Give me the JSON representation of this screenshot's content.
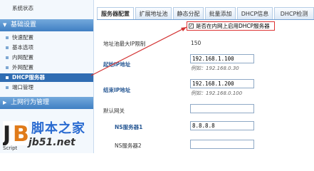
{
  "sidebar": {
    "system_status": "系统状态",
    "basic_settings": "基础设置",
    "items": [
      {
        "label": "快速配置"
      },
      {
        "label": "基本选项"
      },
      {
        "label": "内网配置"
      },
      {
        "label": "外网配置"
      },
      {
        "label": "DHCP服务器"
      },
      {
        "label": "端口管理"
      }
    ],
    "behavior": "上网行为管理"
  },
  "tabs": [
    "服务器配置",
    "扩展地址池",
    "静态分配",
    "批量添加",
    "DHCP信息",
    "DHCP检测"
  ],
  "form": {
    "enable_label": "是否在内网上启用DHCP服务器",
    "pool_max_label": "地址池最大IP限制",
    "pool_max_value": "150",
    "start_ip_label": "起始IP地址",
    "start_ip_value": "192.168.1.100",
    "start_ip_hint": "例如：192.168.0.30",
    "end_ip_label": "结束IP地址",
    "end_ip_value": "192.168.1.200",
    "end_ip_hint": "例如：192.168.0.100",
    "gateway_label": "默认网关",
    "gateway_value": "",
    "dns1_label": "NS服务器1",
    "dns1_value": "8.8.8.8",
    "dns2_label": "NS服务器2",
    "dns2_value": ""
  },
  "watermark": {
    "title": "脚本之家",
    "url": "jb51.net",
    "script": "Script"
  },
  "colors": {
    "accent": "#2f6db3",
    "highlight": "#d33333"
  }
}
